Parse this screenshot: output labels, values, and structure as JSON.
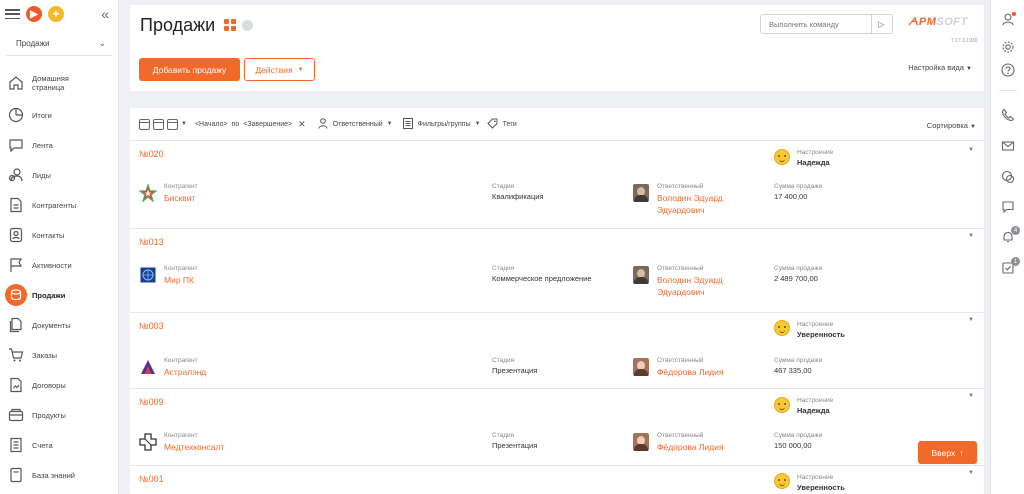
{
  "workspace": {
    "selected": "Продажи"
  },
  "nav": [
    {
      "label": "Домашняя страница",
      "icon": "home-icon"
    },
    {
      "label": "Итоги",
      "icon": "pie-chart-icon"
    },
    {
      "label": "Лента",
      "icon": "feed-icon"
    },
    {
      "label": "Лиды",
      "icon": "leads-icon"
    },
    {
      "label": "Контрагенты",
      "icon": "accounts-icon"
    },
    {
      "label": "Контакты",
      "icon": "contacts-icon"
    },
    {
      "label": "Активности",
      "icon": "flag-icon"
    },
    {
      "label": "Продажи",
      "icon": "sales-icon",
      "active": true
    },
    {
      "label": "Документы",
      "icon": "documents-icon"
    },
    {
      "label": "Заказы",
      "icon": "cart-icon"
    },
    {
      "label": "Договоры",
      "icon": "contracts-icon"
    },
    {
      "label": "Продукты",
      "icon": "products-icon"
    },
    {
      "label": "Счета",
      "icon": "invoices-icon"
    },
    {
      "label": "База знаний",
      "icon": "knowledge-icon"
    }
  ],
  "header": {
    "title": "Продажи",
    "command_placeholder": "Выполнить команду",
    "logo_part1": "ᗅPM",
    "logo_part2": "SOFT",
    "version": "7.17.3.1930",
    "add_button": "Добавить продажу",
    "actions_button": "Действия",
    "view_settings": "Настройка вида"
  },
  "filters": {
    "start": "<Начало>",
    "by": "по",
    "end": "<Завершение>",
    "owner": "Ответственный",
    "filters_groups": "Фильтры/группы",
    "tags": "Теги",
    "sorting": "Сортировка"
  },
  "labels": {
    "account": "Контрагент",
    "stage": "Стадия",
    "owner": "Ответственный",
    "amount": "Сумма продажи",
    "mood": "Настроение"
  },
  "opportunities": [
    {
      "number": "№020",
      "account": "Бисквит",
      "stage": "Квалификация",
      "owner_line1": "Володин Эдуард",
      "owner_line2": "Эдуардович",
      "amount": "17 400,00",
      "mood": "Надежда"
    },
    {
      "number": "№013",
      "account": "Мир ПК",
      "stage": "Коммерческое предложение",
      "owner_line1": "Володин Эдуард",
      "owner_line2": "Эдуардович",
      "amount": "2 489 700,00",
      "mood": ""
    },
    {
      "number": "№003",
      "account": "Астралэнд",
      "stage": "Презентация",
      "owner_line1": "Фёдорова Лидия",
      "owner_line2": "",
      "amount": "467 335,00",
      "mood": "Уверенность"
    },
    {
      "number": "№009",
      "account": "Медтехконсалт",
      "stage": "Презентация",
      "owner_line1": "Фёдорова Лидия",
      "owner_line2": "",
      "amount": "150 000,00",
      "mood": "Надежда"
    },
    {
      "number": "№001",
      "mood": "Уверенность"
    }
  ],
  "up_button": "Вверх",
  "rightbar": {
    "notifications_count": "4",
    "tasks_count": "1"
  },
  "colors": {
    "accent": "#f26a2a",
    "accent_yellow": "#f8b62a"
  }
}
